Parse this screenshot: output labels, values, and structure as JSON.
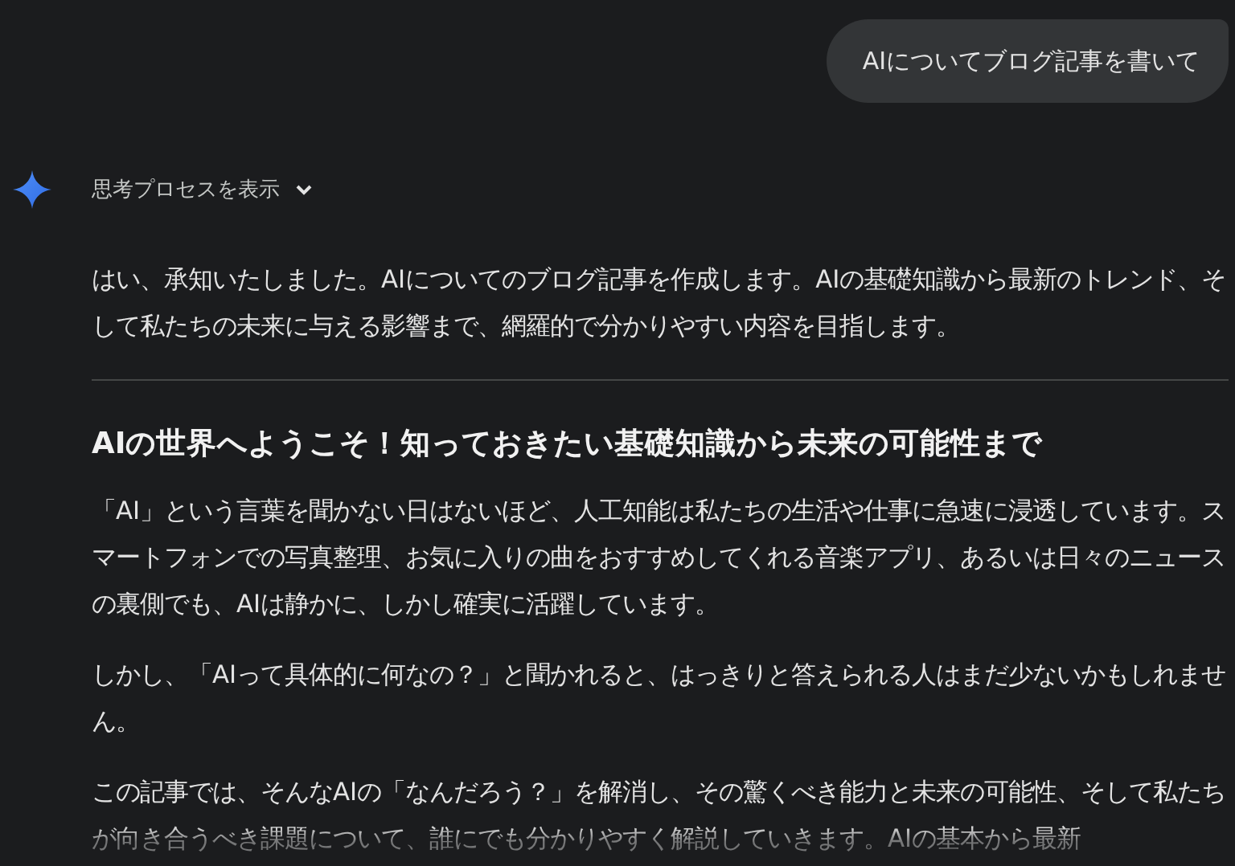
{
  "user_message": "AIについてブログ記事を書いて",
  "thinking_toggle": {
    "label": "思考プロセスを表示",
    "expanded": false
  },
  "response": {
    "intro": "はい、承知いたしました。AIについてのブログ記事を作成します。AIの基礎知識から最新のトレンド、そして私たちの未来に与える影響まで、網羅的で分かりやすい内容を目指します。",
    "heading": "AIの世界へようこそ！知っておきたい基礎知識から未来の可能性まで",
    "paragraphs": [
      "「AI」という言葉を聞かない日はないほど、人工知能は私たちの生活や仕事に急速に浸透しています。スマートフォンでの写真整理、お気に入りの曲をおすすめしてくれる音楽アプリ、あるいは日々のニュースの裏側でも、AIは静かに、しかし確実に活躍しています。",
      "しかし、「AIって具体的に何なの？」と聞かれると、はっきりと答えられる人はまだ少ないかもしれません。",
      "この記事では、そんなAIの「なんだろう？」を解消し、その驚くべき能力と未来の可能性、そして私たちが向き合うべき課題について、誰にでも分かりやすく解説していきます。AIの基本から最新"
    ]
  }
}
